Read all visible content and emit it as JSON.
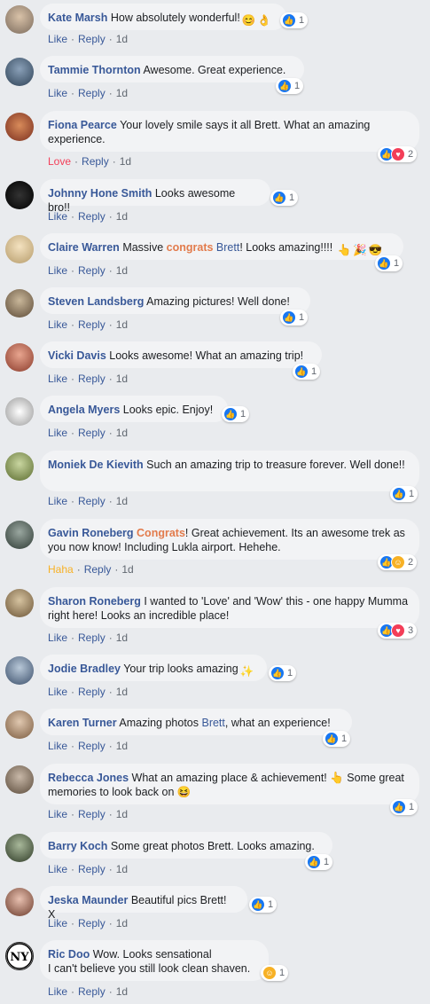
{
  "comments": [
    {
      "author": "Kate Marsh",
      "text": "How absolutely wonderful!",
      "emojis": [
        "😊",
        "👌"
      ],
      "reactions": [
        "like"
      ],
      "react_count": "1",
      "action": "Like",
      "reply": "Reply",
      "time": "1d"
    },
    {
      "author": "Tammie Thornton",
      "text": "Awesome. Great experience.",
      "reactions": [
        "like"
      ],
      "react_count": "1",
      "action": "Like",
      "reply": "Reply",
      "time": "1d"
    },
    {
      "author": "Fiona Pearce",
      "text": "Your lovely smile says it all Brett. What an amazing experience.",
      "reactions": [
        "like",
        "love"
      ],
      "react_count": "2",
      "action": "Love",
      "reply": "Reply",
      "time": "1d"
    },
    {
      "author": "Johnny Hone Smith",
      "text": "Looks awesome bro!!",
      "reactions": [
        "like"
      ],
      "react_count": "1",
      "action": "Like",
      "reply": "Reply",
      "time": "1d"
    },
    {
      "author": "Claire Warren",
      "text_pre": "Massive ",
      "text_hl": "congrats",
      "text_mid": " ",
      "text_hl2": "Brett",
      "text_post": "! Looks amazing!!!!",
      "emojis": [
        "👆",
        "🎉",
        "😎"
      ],
      "reactions": [
        "like"
      ],
      "react_count": "1",
      "action": "Like",
      "reply": "Reply",
      "time": "1d"
    },
    {
      "author": "Steven Landsberg",
      "text": "Amazing pictures! Well done!",
      "reactions": [
        "like"
      ],
      "react_count": "1",
      "action": "Like",
      "reply": "Reply",
      "time": "1d"
    },
    {
      "author": "Vicki Davis",
      "text": "Looks awesome! What an amazing trip!",
      "reactions": [
        "like"
      ],
      "react_count": "1",
      "action": "Like",
      "reply": "Reply",
      "time": "1d"
    },
    {
      "author": "Angela Myers",
      "text": "Looks epic. Enjoy!",
      "reactions": [
        "like"
      ],
      "react_count": "1",
      "action": "Like",
      "reply": "Reply",
      "time": "1d"
    },
    {
      "author": "Moniek De Kievith",
      "text": "Such an amazing trip to treasure forever. Well done!!",
      "reactions": [
        "like"
      ],
      "react_count": "1",
      "action": "Like",
      "reply": "Reply",
      "time": "1d"
    },
    {
      "author": "Gavin Roneberg",
      "text_hl": "Congrats",
      "text_post": "! Great achievement. Its an awesome trek as you now know! Including Lukla airport. Hehehe.",
      "reactions": [
        "like",
        "haha"
      ],
      "react_count": "2",
      "action": "Haha",
      "reply": "Reply",
      "time": "1d"
    },
    {
      "author": "Sharon Roneberg",
      "text": "I wanted to 'Love' and 'Wow' this - one happy Mumma right here! Looks an incredible place!",
      "reactions": [
        "like",
        "love"
      ],
      "react_count": "3",
      "action": "Like",
      "reply": "Reply",
      "time": "1d"
    },
    {
      "author": "Jodie Bradley",
      "text": "Your trip looks amazing",
      "emojis": [
        "✨"
      ],
      "reactions": [
        "like"
      ],
      "react_count": "1",
      "action": "Like",
      "reply": "Reply",
      "time": "1d"
    },
    {
      "author": "Karen Turner",
      "text_pre": "Amazing photos ",
      "text_hl2": "Brett",
      "text_post": ", what an experience!",
      "reactions": [
        "like"
      ],
      "react_count": "1",
      "action": "Like",
      "reply": "Reply",
      "time": "1d"
    },
    {
      "author": "Rebecca Jones",
      "text": "What an amazing place & achievement! 👆 Some great memories to look back on 😆",
      "reactions": [
        "like"
      ],
      "react_count": "1",
      "action": "Like",
      "reply": "Reply",
      "time": "1d"
    },
    {
      "author": "Barry Koch",
      "text": "Some great photos Brett. Looks amazing.",
      "reactions": [
        "like"
      ],
      "react_count": "1",
      "action": "Like",
      "reply": "Reply",
      "time": "1d"
    },
    {
      "author": "Jeska Maunder",
      "text": "Beautiful pics Brett! X",
      "reactions": [
        "like"
      ],
      "react_count": "1",
      "action": "Like",
      "reply": "Reply",
      "time": "1d"
    },
    {
      "author": "Ric Doo",
      "text": "Wow. Looks sensational",
      "text_line2": "I can't believe you still look clean shaven.",
      "reactions": [
        "haha"
      ],
      "react_count": "1",
      "action": "Like",
      "reply": "Reply",
      "time": "1d"
    }
  ],
  "colors": {
    "link": "#385898",
    "like": "#1877f2",
    "love": "#f33e58",
    "haha": "#f7b125",
    "bubble": "#f2f3f5",
    "background": "#e9ebee"
  }
}
